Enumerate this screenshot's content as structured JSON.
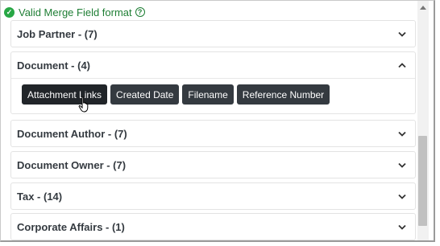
{
  "status": {
    "text": "Valid Merge Field format",
    "check_icon": "check-circle-icon",
    "help_icon": "question-circle-icon",
    "color": "#28a745"
  },
  "sections": [
    {
      "label": "Job Partner - (7)",
      "expanded": false
    },
    {
      "label": "Document - (4)",
      "expanded": true,
      "tags": [
        "Attachment Links",
        "Created Date",
        "Filename",
        "Reference Number"
      ]
    },
    {
      "label": "Document Author - (7)",
      "expanded": false
    },
    {
      "label": "Document Owner - (7)",
      "expanded": false
    },
    {
      "label": "Tax - (14)",
      "expanded": false
    },
    {
      "label": "Corporate Affairs - (1)",
      "expanded": false
    }
  ],
  "colors": {
    "tag_bg": "#343a40",
    "text": "#343a40"
  }
}
